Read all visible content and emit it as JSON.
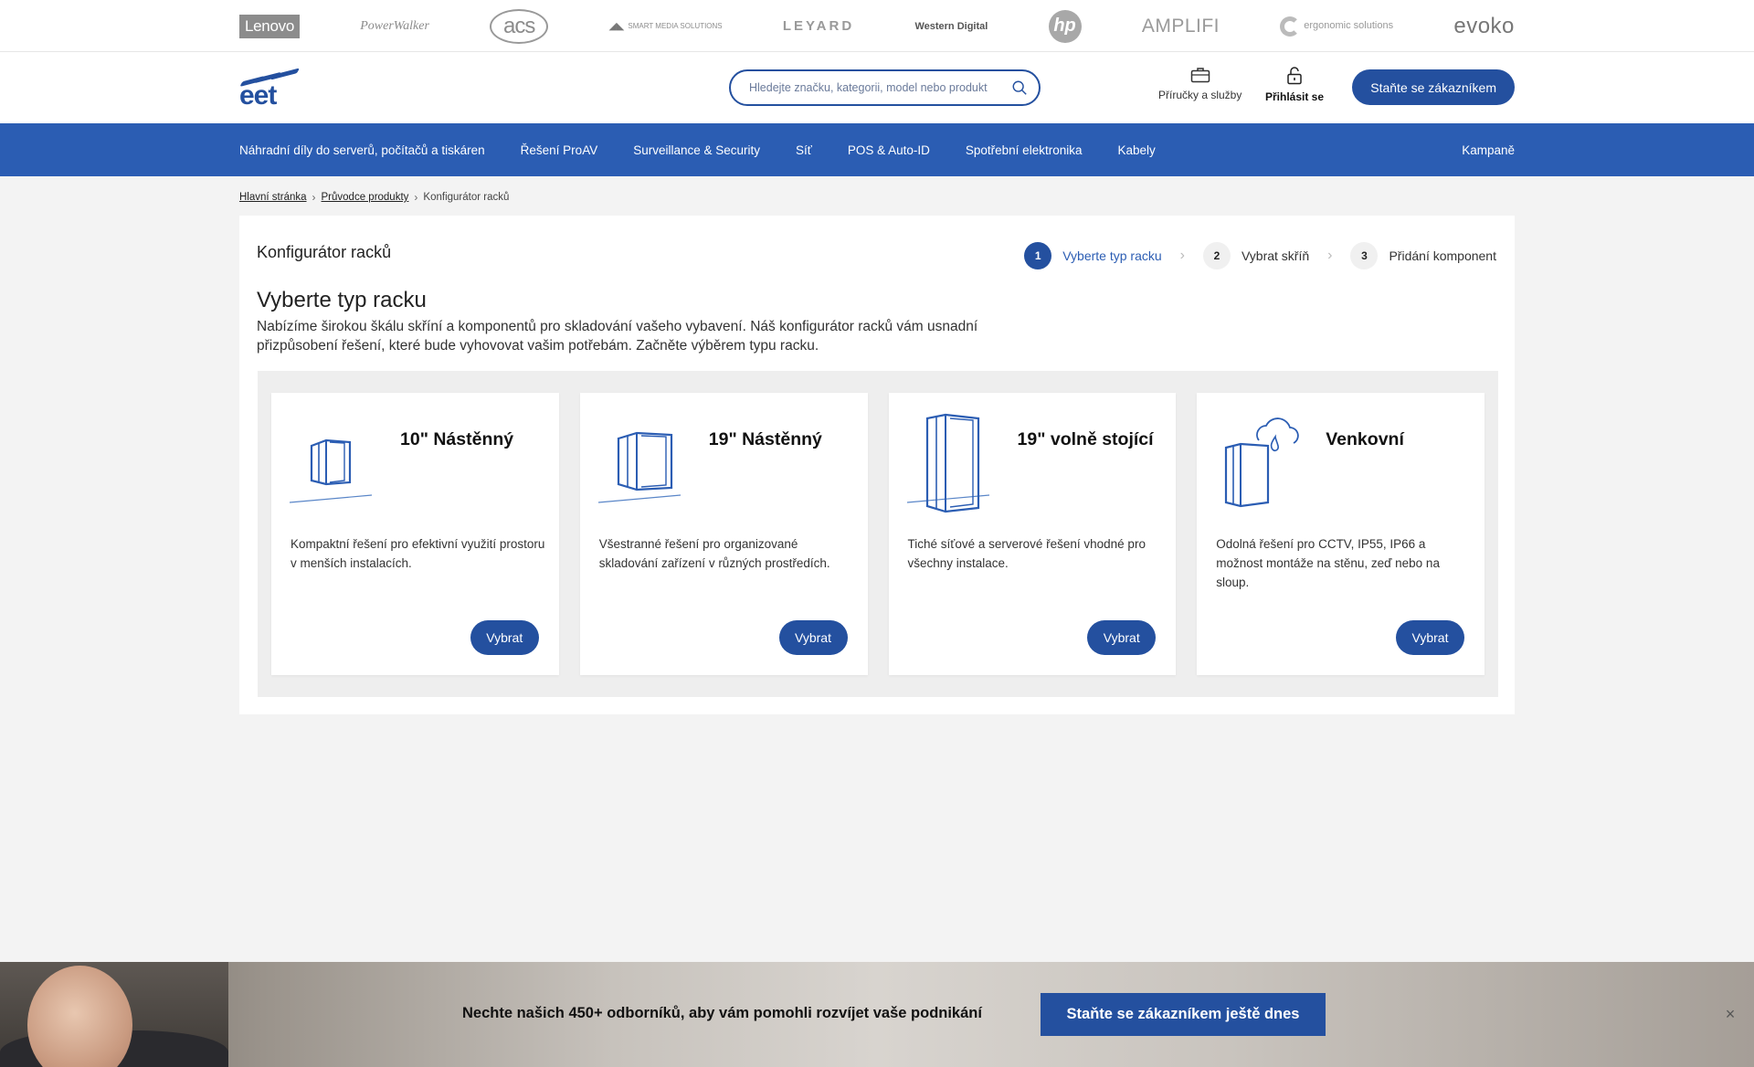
{
  "brands": {
    "lenovo": "Lenovo",
    "powerwalker": "PowerWalker",
    "acs": "acs",
    "sms": "SMART MEDIA SOLUTIONS",
    "leyard": "LEYARD",
    "wd": "Western Digital",
    "hp": "hp",
    "amplifi": "AMPLIFI",
    "ergonomic": "ergonomic solutions",
    "evoko": "evoko"
  },
  "header": {
    "logo_text": "eet",
    "search_placeholder": "Hledejte značku, kategorii, model nebo produkt",
    "manuals_label": "Příručky a služby",
    "login_label": "Přihlásit se",
    "cta_label": "Staňte se zákazníkem",
    "accent": "#24509f"
  },
  "nav": {
    "items": [
      "Náhradní díly do serverů, počítačů a tiskáren",
      "Řešení ProAV",
      "Surveillance & Security",
      "Síť",
      "POS & Auto-ID",
      "Spotřební elektronika",
      "Kabely"
    ],
    "right": "Kampaně",
    "color": "#2b5db3"
  },
  "breadcrumb": {
    "home": "Hlavní stránka",
    "guide": "Průvodce produkty",
    "current": "Konfigurátor racků"
  },
  "panel": {
    "title": "Konfigurátor racků",
    "steps": [
      {
        "num": "1",
        "label": "Vyberte typ racku"
      },
      {
        "num": "2",
        "label": "Vybrat skříň"
      },
      {
        "num": "3",
        "label": "Přidání komponent"
      }
    ],
    "heading": "Vyberte typ racku",
    "intro": "Nabízíme širokou škálu skříní a komponentů pro skladování vašeho vybavení. Náš konfigurátor racků vám usnadní přizpůsobení řešení, které bude vyhovovat vašim potřebám. Začněte výběrem typu racku."
  },
  "cards": [
    {
      "title": "10\" Nástěnný",
      "desc": "Kompaktní řešení pro efektivní využití prostoru v menších instalacích.",
      "button": "Vybrat",
      "icon": "wall-rack-10-icon"
    },
    {
      "title": "19\" Nástěnný",
      "desc": "Všestranné řešení pro organizované skladování zařízení v různých prostředích.",
      "button": "Vybrat",
      "icon": "wall-rack-19-icon"
    },
    {
      "title": "19\" volně stojící",
      "desc": "Tiché síťové a serverové řešení vhodné pro všechny instalace.",
      "button": "Vybrat",
      "icon": "floor-rack-icon"
    },
    {
      "title": "Venkovní",
      "desc": "Odolná řešení pro CCTV, IP55, IP66 a možnost montáže na stěnu, zeď nebo na sloup.",
      "button": "Vybrat",
      "icon": "outdoor-rack-icon"
    }
  ],
  "banner": {
    "message": "Nechte našich 450+ odborníků, aby vám pomohli rozvíjet vaše podnikání",
    "cta": "Staňte se zákazníkem ještě dnes",
    "close": "×"
  }
}
